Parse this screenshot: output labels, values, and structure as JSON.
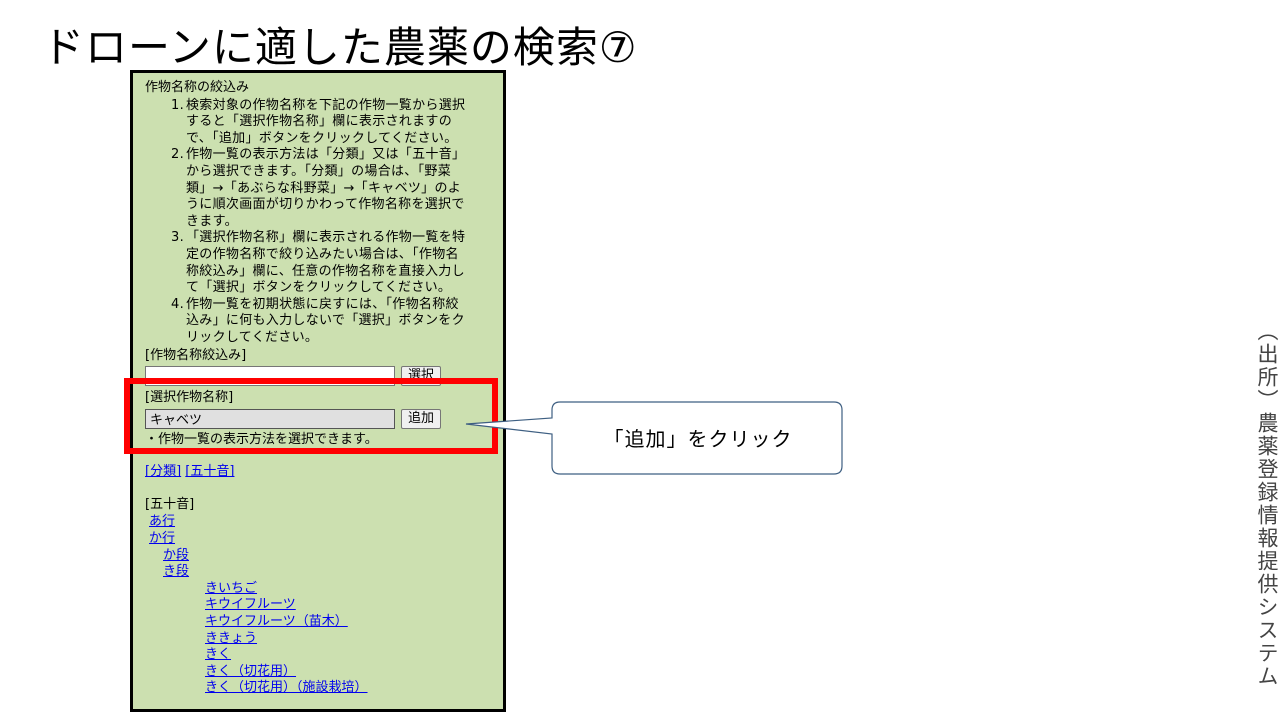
{
  "slide": {
    "title": "ドローンに適した農薬の検索⑦",
    "source_label": "（出所）農薬登録情報提供システム",
    "callout_text": "「追加」をクリック"
  },
  "panel": {
    "section_title": "作物名称の絞込み",
    "instructions": [
      {
        "num": "1.",
        "lines": [
          "検索対象の作物名称を下記の作物一覧から選択",
          "すると「選択作物名称」欄に表示されますの",
          "で、「追加」ボタンをクリックしてください。"
        ]
      },
      {
        "num": "2.",
        "lines": [
          "作物一覧の表示方法は「分類」又は「五十音」",
          "から選択できます。「分類」の場合は、「野菜",
          "類」→「あぶらな科野菜」→「キャベツ」のよ",
          "うに順次画面が切りかわって作物名称を選択で",
          "きます。"
        ]
      },
      {
        "num": "3.",
        "lines": [
          "「選択作物名称」欄に表示される作物一覧を特",
          "定の作物名称で絞り込みたい場合は、「作物名",
          "称絞込み」欄に、任意の作物名称を直接入力し",
          "て「選択」ボタンをクリックしてください。"
        ]
      },
      {
        "num": "4.",
        "lines": [
          "作物一覧を初期状態に戻すには、「作物名称絞",
          "込み」に何も入力しないで「選択」ボタンをク",
          "リックしてください。"
        ]
      }
    ],
    "filter_label": "[作物名称絞込み]",
    "filter_value": "",
    "select_button": "選択",
    "selected_label": "[選択作物名称]",
    "selected_value": "キャベツ",
    "add_button": "追加",
    "note": "・作物一覧の表示方法を選択できます。",
    "link_bunrui": "[分類]",
    "link_gojuon": "[五十音]",
    "gojuon_title": "[五十音]",
    "tree": {
      "a_gyo": "あ行",
      "ka_gyo": "か行",
      "ka_dan": "か段",
      "ki_dan": "き段",
      "items": [
        "きいちご",
        "キウイフルーツ",
        "キウイフルーツ（苗木）",
        "ききょう",
        "きく",
        "きく（切花用）",
        "きく（切花用）（施設栽培）"
      ]
    }
  }
}
